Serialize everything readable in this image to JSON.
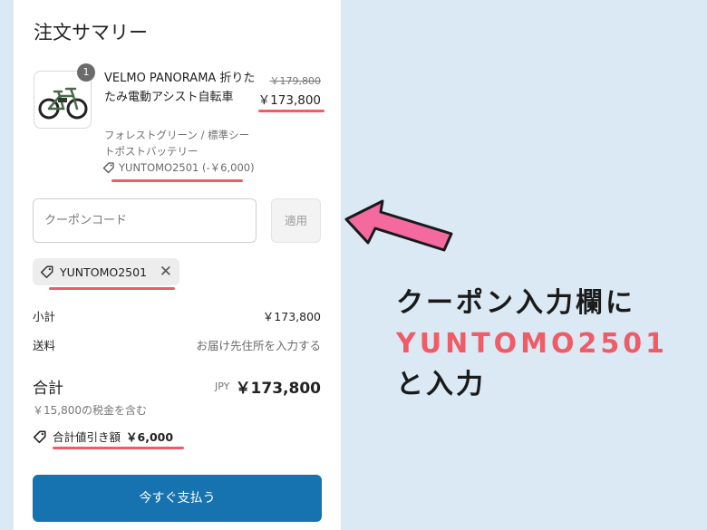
{
  "summary": {
    "title": "注文サマリー"
  },
  "item": {
    "quantity": "1",
    "name": "VELMO PANORAMA 折りたたみ電動アシスト自転車",
    "variant": "フォレストグリーン / 標準シートポストバッテリー",
    "discount": "YUNTOMO2501 (-￥6,000)",
    "price_original": "￥179,800",
    "price": "￥173,800"
  },
  "coupon": {
    "placeholder": "クーポンコード",
    "apply_label": "適用",
    "applied_code": "YUNTOMO2501"
  },
  "totals": {
    "subtotal_label": "小計",
    "subtotal_value": "￥173,800",
    "shipping_label": "送料",
    "shipping_value": "お届け先住所を入力する",
    "total_label": "合計",
    "currency": "JPY",
    "total_value": "￥173,800",
    "tax_note": "￥15,800の税金を含む",
    "savings_label": "合計値引き額",
    "savings_value": "￥6,000"
  },
  "checkout": {
    "pay_label": "今すぐ支払う"
  },
  "annotation": {
    "line1": "クーポン入力欄に",
    "code": "YUNTOMO2501",
    "line3": "と入力"
  },
  "colors": {
    "page_background": "#dbe9f5",
    "accent_underline": "#ef5b66",
    "pay_button": "#1773b0",
    "arrow_fill": "#f46a9e"
  },
  "icons": {
    "tag": "tag-icon",
    "remove": "close-icon",
    "arrow": "arrow-left-icon"
  }
}
